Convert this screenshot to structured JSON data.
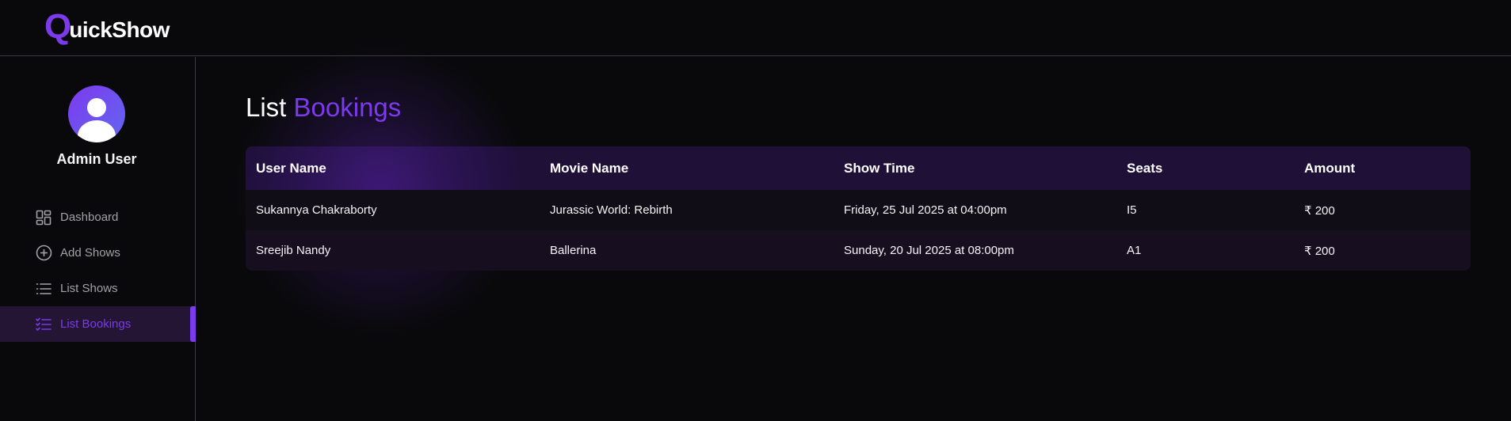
{
  "app": {
    "logo_initial": "Q",
    "logo_rest": "uickShow"
  },
  "colors": {
    "accent": "#7c3aed",
    "background": "#09090b"
  },
  "sidebar": {
    "admin_name": "Admin User",
    "avatar_icon": "user-avatar-icon",
    "items": [
      {
        "label": "Dashboard",
        "icon": "dashboard-icon",
        "active": false
      },
      {
        "label": "Add Shows",
        "icon": "plus-circle-icon",
        "active": false
      },
      {
        "label": "List Shows",
        "icon": "list-icon",
        "active": false
      },
      {
        "label": "List Bookings",
        "icon": "list-checks-icon",
        "active": true
      }
    ]
  },
  "main": {
    "title_plain": "List",
    "title_accent": "Bookings",
    "table": {
      "headers": [
        "User Name",
        "Movie Name",
        "Show Time",
        "Seats",
        "Amount"
      ],
      "rows": [
        [
          "Sukannya Chakraborty",
          "Jurassic World: Rebirth",
          "Friday, 25 Jul 2025 at 04:00pm",
          "I5",
          "₹ 200"
        ],
        [
          "Sreejib Nandy",
          "Ballerina",
          "Sunday, 20 Jul 2025 at 08:00pm",
          "A1",
          "₹ 200"
        ]
      ]
    }
  }
}
